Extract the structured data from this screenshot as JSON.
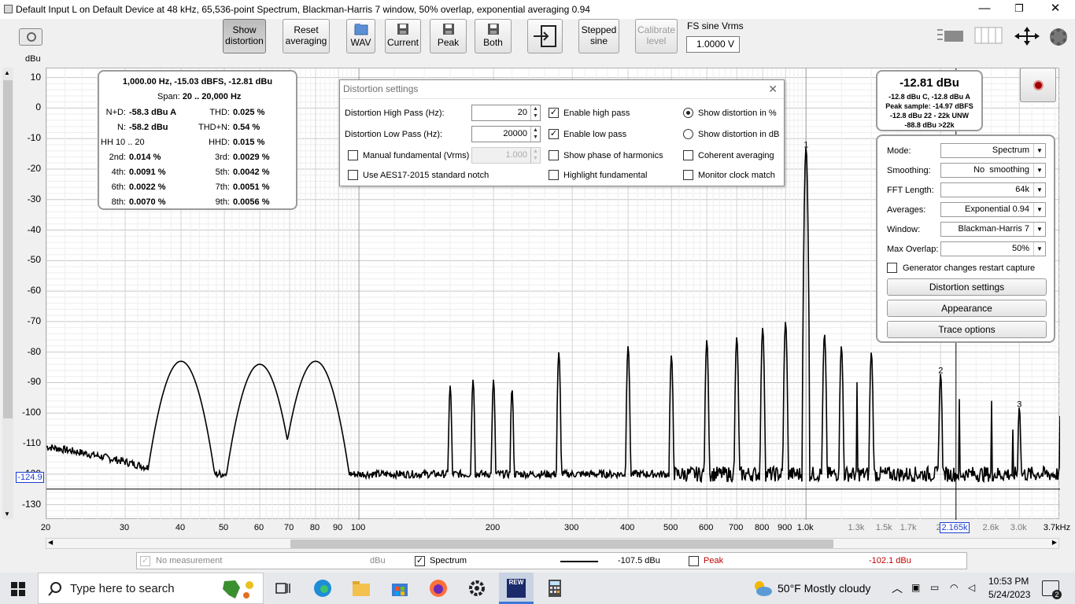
{
  "window": {
    "title": "Default Input L on Default Device at 48 kHz, 65,536-point Spectrum, Blackman-Harris 7 window, 50% overlap, exponential averaging 0.94",
    "minimize": "—",
    "restore": "❐",
    "close": "✕"
  },
  "toolbar": {
    "show_distortion": [
      "Show",
      "distortion"
    ],
    "reset_averaging": [
      "Reset",
      "averaging"
    ],
    "wav": "WAV",
    "current": "Current",
    "peak": "Peak",
    "both": "Both",
    "stepped_sine": [
      "Stepped",
      "sine"
    ],
    "calibrate_level": [
      "Calibrate",
      "level"
    ],
    "fs_label": "FS sine Vrms",
    "fs_value": "1.0000 V"
  },
  "axis": {
    "y_unit": "dBu",
    "y_ticks": [
      "10",
      "0",
      "-10",
      "-20",
      "-30",
      "-40",
      "-50",
      "-60",
      "-70",
      "-80",
      "-90",
      "-100",
      "-110",
      "-120",
      "-130"
    ],
    "x_ticks": [
      "20",
      "30",
      "40",
      "50",
      "60",
      "70",
      "80",
      "90",
      "100",
      "200",
      "300",
      "400",
      "500",
      "600",
      "700",
      "800",
      "900",
      "1.0k",
      "1.3k",
      "1.5k",
      "1.7k",
      "2.",
      "2.6k",
      "3.0k",
      "3.7kHz"
    ],
    "x_ticks_grey": [
      "1.3k",
      "1.5k",
      "1.7k",
      "2.",
      "2.6k",
      "3.0k"
    ],
    "cursor_y": "-124.9",
    "cursor_x": "2.165k",
    "markers": [
      "1",
      "2",
      "3"
    ]
  },
  "chart_data": {
    "type": "line",
    "title": "",
    "xlabel": "",
    "ylabel": "dBu",
    "x_scale": "log",
    "xlim": [
      20,
      3700
    ],
    "ylim": [
      -135,
      13
    ],
    "series": [
      {
        "name": "Spectrum",
        "noise_floor": -120,
        "peaks": [
          {
            "x": 40,
            "y": -83
          },
          {
            "x": 60,
            "y": -84
          },
          {
            "x": 80,
            "y": -83
          },
          {
            "x": 160,
            "y": -91
          },
          {
            "x": 180,
            "y": -89
          },
          {
            "x": 200,
            "y": -89
          },
          {
            "x": 220,
            "y": -92
          },
          {
            "x": 280,
            "y": -80
          },
          {
            "x": 400,
            "y": -78
          },
          {
            "x": 500,
            "y": -81
          },
          {
            "x": 600,
            "y": -76
          },
          {
            "x": 700,
            "y": -75
          },
          {
            "x": 800,
            "y": -72
          },
          {
            "x": 900,
            "y": -70
          },
          {
            "x": 1000,
            "y": -12.8
          },
          {
            "x": 1100,
            "y": -74
          },
          {
            "x": 1200,
            "y": -78
          },
          {
            "x": 1400,
            "y": -80
          },
          {
            "x": 2000,
            "y": -87
          },
          {
            "x": 3000,
            "y": -98
          }
        ]
      }
    ]
  },
  "distortion_panel": {
    "header": "1,000.00 Hz, -15.03 dBFS, -12.81 dBu",
    "span_label": "Span:",
    "span": "20 .. 20,000 Hz",
    "rows": [
      {
        "l1": "N+D:",
        "v1": "-58.3 dBu A",
        "l2": "THD:",
        "v2": "0.025 %"
      },
      {
        "l1": "N:",
        "v1": "-58.2 dBu",
        "l2": "THD+N:",
        "v2": "0.54 %"
      },
      {
        "l1": "HH 10 .. 20",
        "v1": "",
        "l2": "HHD:",
        "v2": "0.015 %"
      },
      {
        "l1": "2nd:",
        "v1": "0.014 %",
        "l2": "3rd:",
        "v2": "0.0029 %"
      },
      {
        "l1": "4th:",
        "v1": "0.0091 %",
        "l2": "5th:",
        "v2": "0.0042 %"
      },
      {
        "l1": "6th:",
        "v1": "0.0022 %",
        "l2": "7th:",
        "v2": "0.0051 %"
      },
      {
        "l1": "8th:",
        "v1": "0.0070 %",
        "l2": "9th:",
        "v2": "0.0056 %"
      }
    ]
  },
  "level_panel": {
    "main": "-12.81 dBu",
    "line1": "-12.8 dBu C, -12.8 dBu A",
    "line2": "Peak sample: -14.97 dBFS",
    "line3": "-12.8 dBu 22 - 22k UNW",
    "line4": "-88.8 dBu >22k"
  },
  "dialog": {
    "title": "Distortion settings",
    "close": "✕",
    "high_pass_label": "Distortion High Pass (Hz):",
    "high_pass": "20",
    "low_pass_label": "Distortion Low Pass (Hz):",
    "low_pass": "20000",
    "manual_fundamental": "Manual fundamental (Vrms)",
    "manual_value": "1.000",
    "aes17": "Use AES17-2015 standard notch",
    "enable_high_pass": "Enable high pass",
    "enable_low_pass": "Enable low pass",
    "show_phase": "Show phase of harmonics",
    "highlight_fundamental": "Highlight fundamental",
    "show_pct": "Show distortion in %",
    "show_db": "Show distortion in dB",
    "coherent": "Coherent averaging",
    "monitor_clock": "Monitor clock match"
  },
  "controls": {
    "mode_label": "Mode:",
    "mode": "Spectrum",
    "smoothing_label": "Smoothing:",
    "smoothing": "No  smoothing",
    "fft_label": "FFT Length:",
    "fft": "64k",
    "averages_label": "Averages:",
    "averages": "Exponential 0.94",
    "window_label": "Window:",
    "window": "Blackman-Harris 7",
    "overlap_label": "Max Overlap:",
    "overlap": "50%",
    "generator_restart": "Generator changes restart capture",
    "distortion_settings": "Distortion settings",
    "appearance": "Appearance",
    "trace_options": "Trace options"
  },
  "legend": {
    "no_measurement": "No measurement",
    "unit": "dBu",
    "spectrum": "Spectrum",
    "spectrum_value": "-107.5 dBu",
    "peak": "Peak",
    "peak_value": "-102.1 dBu",
    "peak_color": "#c00000"
  },
  "taskbar": {
    "search_placeholder": "Type here to search",
    "weather": "50°F  Mostly cloudy",
    "time": "10:53 PM",
    "date": "5/24/2023",
    "notifications": "2",
    "rew_label": "REW"
  }
}
